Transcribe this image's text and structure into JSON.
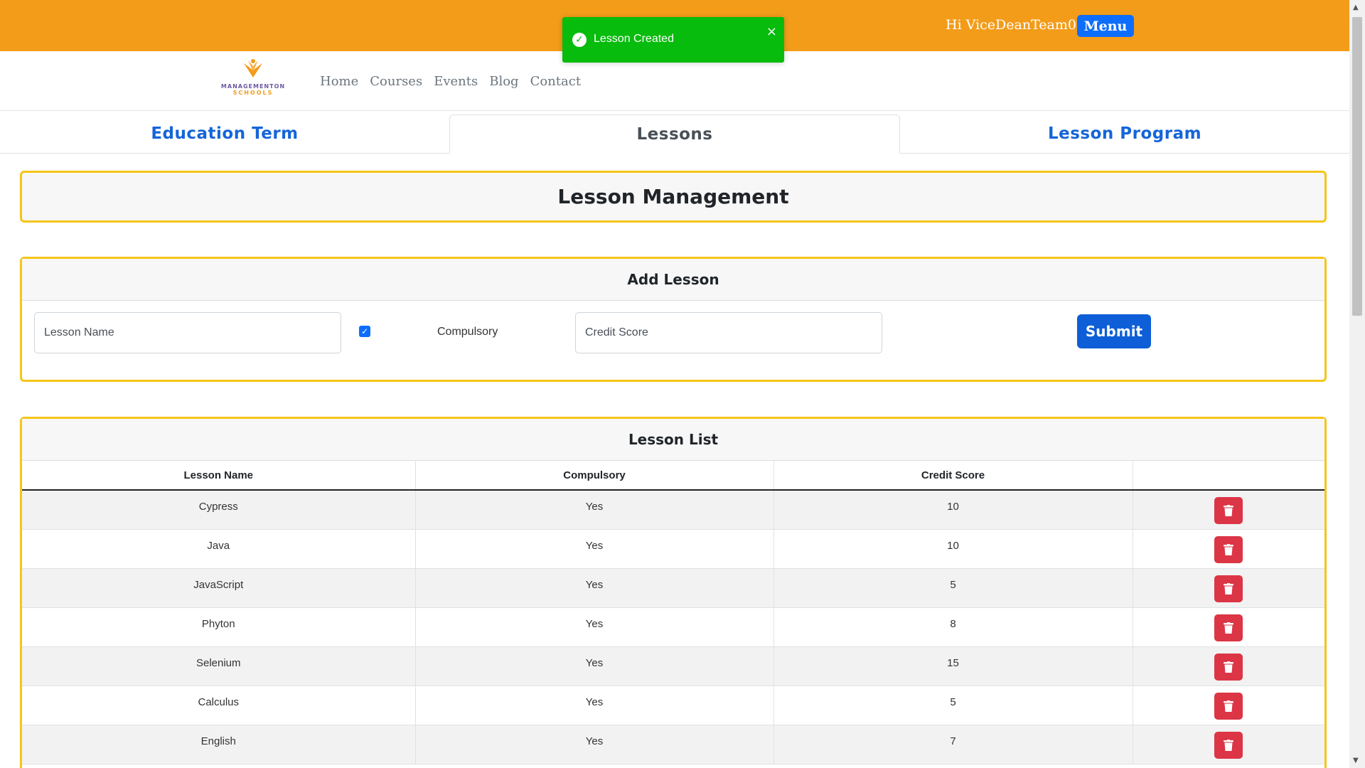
{
  "header": {
    "greeting": "Hi ViceDeanTeam05",
    "menu_label": "Menu"
  },
  "toast": {
    "message": "Lesson Created",
    "close": "×",
    "check": "✓"
  },
  "logo": {
    "line1": "MANAGEMENTON",
    "line2": "SCHOOLS"
  },
  "nav": {
    "links": [
      "Home",
      "Courses",
      "Events",
      "Blog",
      "Contact"
    ]
  },
  "tabs": [
    "Education Term",
    "Lessons",
    "Lesson Program"
  ],
  "page_title": "Lesson Management",
  "add_lesson": {
    "title": "Add Lesson",
    "lesson_name_placeholder": "Lesson Name",
    "compulsory_label": "Compulsory",
    "compulsory_checked": true,
    "credit_score_placeholder": "Credit Score",
    "submit_label": "Submit"
  },
  "lesson_list": {
    "title": "Lesson List",
    "columns": [
      "Lesson Name",
      "Compulsory",
      "Credit Score",
      ""
    ],
    "rows": [
      {
        "name": "Cypress",
        "compulsory": "Yes",
        "credit": "10"
      },
      {
        "name": "Java",
        "compulsory": "Yes",
        "credit": "10"
      },
      {
        "name": "JavaScript",
        "compulsory": "Yes",
        "credit": "5"
      },
      {
        "name": "Phyton",
        "compulsory": "Yes",
        "credit": "8"
      },
      {
        "name": "Selenium",
        "compulsory": "Yes",
        "credit": "15"
      },
      {
        "name": "Calculus",
        "compulsory": "Yes",
        "credit": "5"
      },
      {
        "name": "English",
        "compulsory": "Yes",
        "credit": "7"
      }
    ]
  },
  "colors": {
    "topbar": "#f39c1a",
    "accent_blue": "#0d6efd",
    "panel_border": "#f5c518",
    "toast_green": "#07bc0c",
    "delete_red": "#dc3545"
  },
  "icons": {
    "delete": "trash-icon",
    "toast": "check-circle-icon"
  }
}
